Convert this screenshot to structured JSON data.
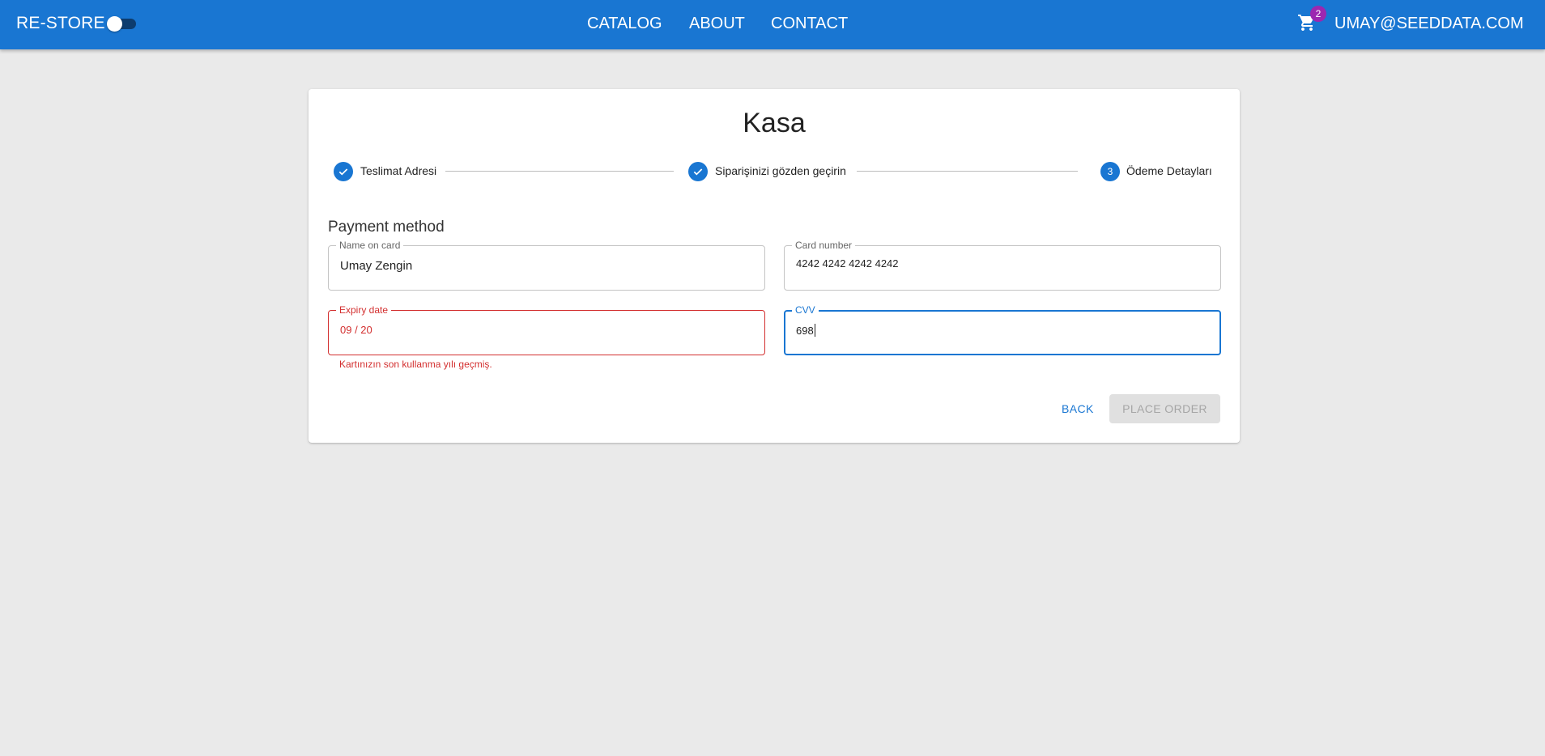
{
  "appbar": {
    "brand": "RE-STORE",
    "theme_toggle_on": false,
    "nav": [
      "CATALOG",
      "ABOUT",
      "CONTACT"
    ],
    "cart_count": "2",
    "user": "UMAY@SEEDDATA.COM"
  },
  "checkout": {
    "title": "Kasa",
    "steps": [
      {
        "label": "Teslimat Adresi",
        "state": "completed",
        "icon": "check-icon"
      },
      {
        "label": "Siparişinizi gözden geçirin",
        "state": "completed",
        "icon": "check-icon"
      },
      {
        "label": "Ödeme Detayları",
        "state": "active",
        "number": "3"
      }
    ],
    "section_title": "Payment method",
    "fields": {
      "name_on_card": {
        "label": "Name on card",
        "value": "Umay Zengin"
      },
      "card_number": {
        "label": "Card number",
        "value": "4242 4242 4242 4242"
      },
      "expiry_date": {
        "label": "Expiry date",
        "value": "09 / 20",
        "error": "Kartınızın son kullanma yılı geçmiş."
      },
      "cvv": {
        "label": "CVV",
        "value": "698"
      }
    },
    "buttons": {
      "back": "BACK",
      "place_order": "PLACE ORDER"
    }
  },
  "colors": {
    "primary": "#1976d2",
    "error": "#d32f2f",
    "badge": "#9c27b0",
    "background": "#eaeaea"
  }
}
